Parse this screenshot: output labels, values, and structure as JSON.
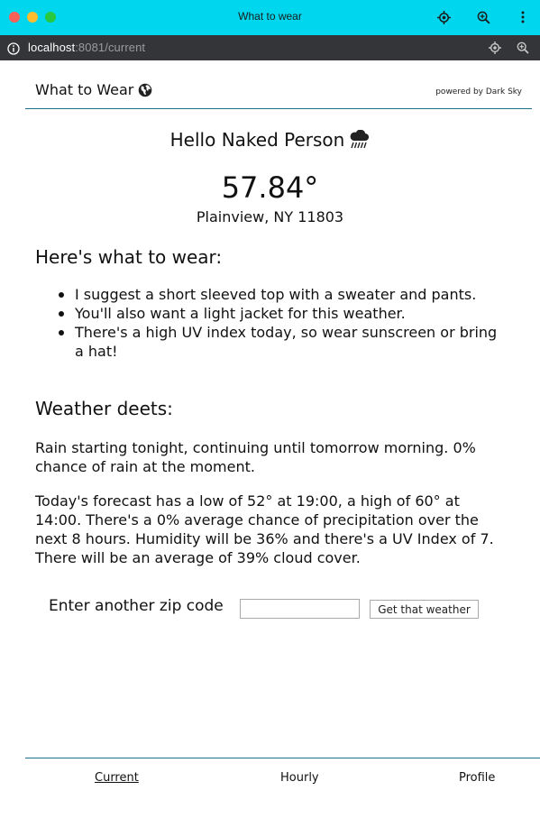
{
  "window": {
    "title": "What to wear",
    "icons": [
      "location-target-icon",
      "zoom-icon",
      "more-vertical-icon"
    ]
  },
  "url_bar": {
    "host": "localhost",
    "rest": ":8081/current",
    "icons": [
      "info-icon",
      "location-target-icon",
      "zoom-icon"
    ]
  },
  "header": {
    "brand": "What to Wear",
    "brand_icon": "globe-icon",
    "powered_by": "powered by Dark Sky"
  },
  "main": {
    "greeting": "Hello Naked Person",
    "greeting_icon": "rain-cloud-icon",
    "temperature": "57.84°",
    "location": "Plainview, NY 11803",
    "wear_heading": "Here's what to wear:",
    "wear_items": [
      "I suggest a short sleeved top with a sweater and pants.",
      "You'll also want a light jacket for this weather.",
      "There's a high UV index today, so wear sunscreen or bring a hat!"
    ],
    "deets_heading": "Weather deets:",
    "summary": "Rain starting tonight, continuing until tomorrow morning. 0% chance of rain at the moment.",
    "forecast": "Today's forecast has a low of 52° at 19:00, a high of 60° at 14:00. There's a 0% average chance of precipitation over the next 8 hours. Humidity will be 36% and there's a UV Index of 7. There will be an average of 39% cloud cover."
  },
  "zip_form": {
    "label": "Enter another zip code",
    "value": "",
    "button": "Get that weather"
  },
  "nav": {
    "current": "Current",
    "hourly": "Hourly",
    "profile": "Profile"
  },
  "colors": {
    "titlebar": "#00d7ee",
    "urlbar": "#343538",
    "rule": "#1e6f88"
  }
}
